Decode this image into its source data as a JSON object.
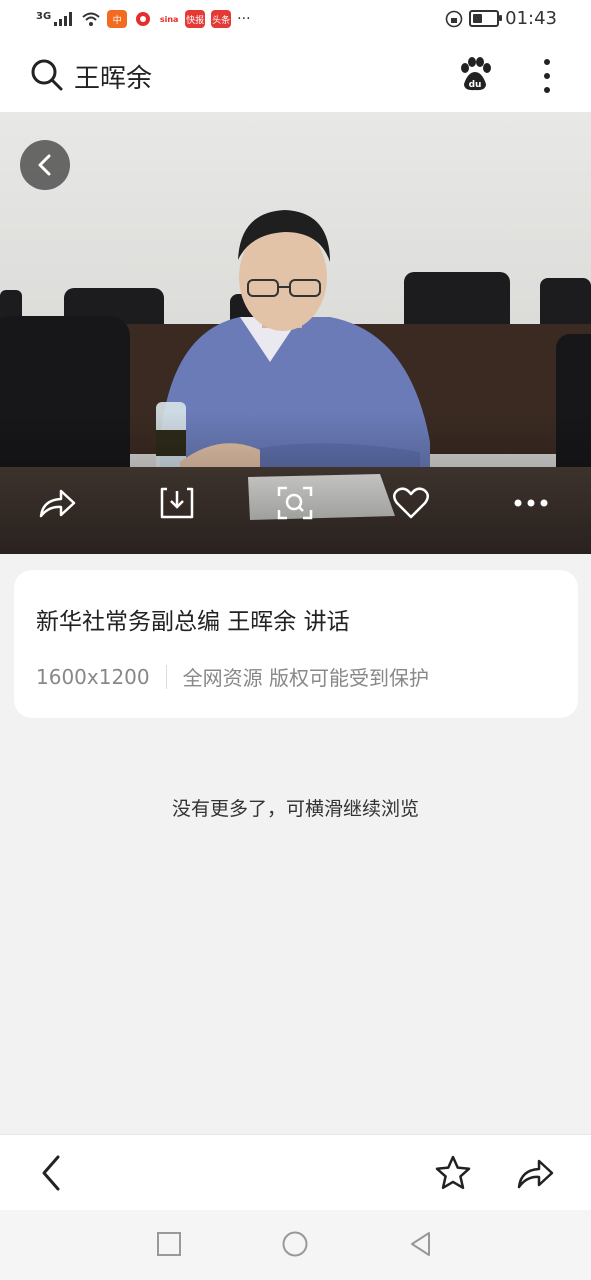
{
  "status_bar": {
    "network": "3G",
    "apps": [
      "中",
      "",
      "",
      "快报",
      "头条"
    ],
    "more": "···",
    "time": "01:43",
    "battery_level": 0.4
  },
  "header": {
    "query": "王晖余"
  },
  "image_card": {
    "title": "新华社常务副总编 王晖余 讲话",
    "resolution": "1600x1200",
    "source_note": "全网资源 版权可能受到保护"
  },
  "end_note": "没有更多了，可横滑继续浏览",
  "colors": {
    "background": "#f2f2f2",
    "card": "#ffffff",
    "text_primary": "#222222",
    "text_secondary": "#888888"
  },
  "icons": {
    "search": "search-icon",
    "baidu": "baidu-paw-icon",
    "more": "more-vertical-icon",
    "back": "chevron-left-icon",
    "share": "share-icon",
    "download": "download-icon",
    "lens": "image-search-icon",
    "like": "heart-icon",
    "more_h": "more-horizontal-icon",
    "star": "star-icon"
  }
}
